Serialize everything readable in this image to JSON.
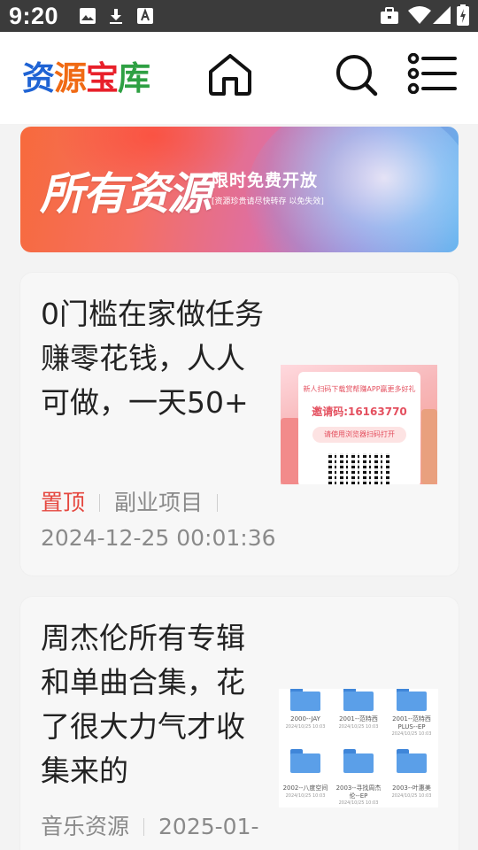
{
  "status_bar": {
    "time": "9:20",
    "icons": [
      "image-icon",
      "download-icon",
      "text-a-icon",
      "briefcase-icon",
      "wifi-icon",
      "signal-icon",
      "battery-charging-icon"
    ]
  },
  "header": {
    "logo": [
      "资",
      "源",
      "宝",
      "库"
    ],
    "icons": [
      "home-icon",
      "search-icon",
      "menu-list-icon"
    ]
  },
  "banner": {
    "main_text": "所有资源",
    "headline": "限时免费开放",
    "subtext": "[资源珍贵请尽快转存 以免失效]"
  },
  "posts": [
    {
      "title": "0门槛在家做任务赚零花钱，人人可做，一天50+",
      "tag": "置顶",
      "category": "副业项目",
      "date": "2024-12-25 00:01:36",
      "thumb": {
        "top_line": "新人扫码下载赏帮赚APP赢更多好礼",
        "invite": "邀请码:16163770",
        "pill": "请使用浏览器扫码打开"
      }
    },
    {
      "title": "周杰伦所有专辑和单曲合集，花了很大力气才收集来的",
      "category": "音乐资源",
      "date": "2025-01-",
      "thumb": {
        "folders": [
          {
            "name": "2000--JAY",
            "date": "2024/10/25 10:03"
          },
          {
            "name": "2001--范特西",
            "date": "2024/10/25 10:03"
          },
          {
            "name": "2001--范特西 PLUS--EP",
            "date": "2024/10/25 10:03"
          },
          {
            "name": "2002--八度空间",
            "date": "2024/10/25 10:03"
          },
          {
            "name": "2003--寻找周杰伦--EP",
            "date": "2024/10/25 10:03"
          },
          {
            "name": "2003--叶惠美",
            "date": "2024/10/25 10:03"
          }
        ]
      }
    }
  ],
  "colors": {
    "accent_blue": "#1f63d4",
    "accent_orange": "#f06a14",
    "accent_red": "#e8202a",
    "accent_green": "#2ea043",
    "pinned_tag": "#e5473f"
  }
}
